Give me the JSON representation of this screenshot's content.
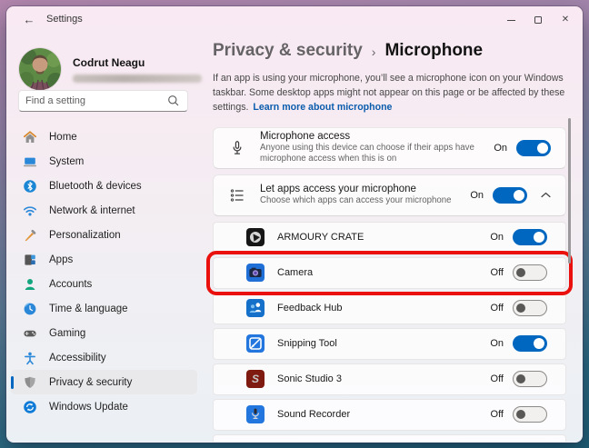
{
  "window": {
    "title": "Settings"
  },
  "icons": {
    "back_arrow": "←",
    "close_glyph": "✕",
    "breadcrumb_separator": "›"
  },
  "colors": {
    "accent": "#0067C0",
    "link_blue": "#0B5CAD",
    "highlight_red": "#E9100D"
  },
  "sidebar": {
    "profile": {
      "name": "Codrut Neagu",
      "email_blurred": true
    },
    "search": {
      "placeholder": "Find a setting"
    },
    "items": [
      {
        "label": "Home",
        "icon": "home-icon",
        "selected": false
      },
      {
        "label": "System",
        "icon": "system-icon",
        "selected": false
      },
      {
        "label": "Bluetooth & devices",
        "icon": "bluetooth-icon",
        "selected": false
      },
      {
        "label": "Network & internet",
        "icon": "network-icon",
        "selected": false
      },
      {
        "label": "Personalization",
        "icon": "personalization-icon",
        "selected": false
      },
      {
        "label": "Apps",
        "icon": "apps-icon",
        "selected": false
      },
      {
        "label": "Accounts",
        "icon": "accounts-icon",
        "selected": false
      },
      {
        "label": "Time & language",
        "icon": "time-language-icon",
        "selected": false
      },
      {
        "label": "Gaming",
        "icon": "gaming-icon",
        "selected": false
      },
      {
        "label": "Accessibility",
        "icon": "accessibility-icon",
        "selected": false
      },
      {
        "label": "Privacy & security",
        "icon": "shield-icon",
        "selected": true
      },
      {
        "label": "Windows Update",
        "icon": "windows-update-icon",
        "selected": false
      }
    ]
  },
  "main": {
    "breadcrumb": {
      "parent": "Privacy & security",
      "current": "Microphone"
    },
    "intro": {
      "text": "If an app is using your microphone, you’ll see a microphone icon on your Windows taskbar. Some desktop apps might not appear on this page or be affected by these settings.",
      "link": "Learn more about microphone"
    },
    "settings": [
      {
        "title": "Microphone access",
        "description": "Anyone using this device can choose if their apps have microphone access when this is on",
        "state": "On",
        "toggle_on": true
      },
      {
        "title": "Let apps access your microphone",
        "description": "Choose which apps can access your microphone",
        "state": "On",
        "toggle_on": true,
        "expanded": true
      }
    ],
    "apps": [
      {
        "name": "ARMOURY CRATE",
        "state": "On",
        "toggle_on": true
      },
      {
        "name": "Camera",
        "state": "Off",
        "toggle_on": false,
        "highlighted": true
      },
      {
        "name": "Feedback Hub",
        "state": "Off",
        "toggle_on": false
      },
      {
        "name": "Snipping Tool",
        "state": "On",
        "toggle_on": true
      },
      {
        "name": "Sonic Studio 3",
        "state": "Off",
        "toggle_on": false,
        "logo_letter": "S"
      },
      {
        "name": "Sound Recorder",
        "state": "Off",
        "toggle_on": false
      }
    ]
  }
}
